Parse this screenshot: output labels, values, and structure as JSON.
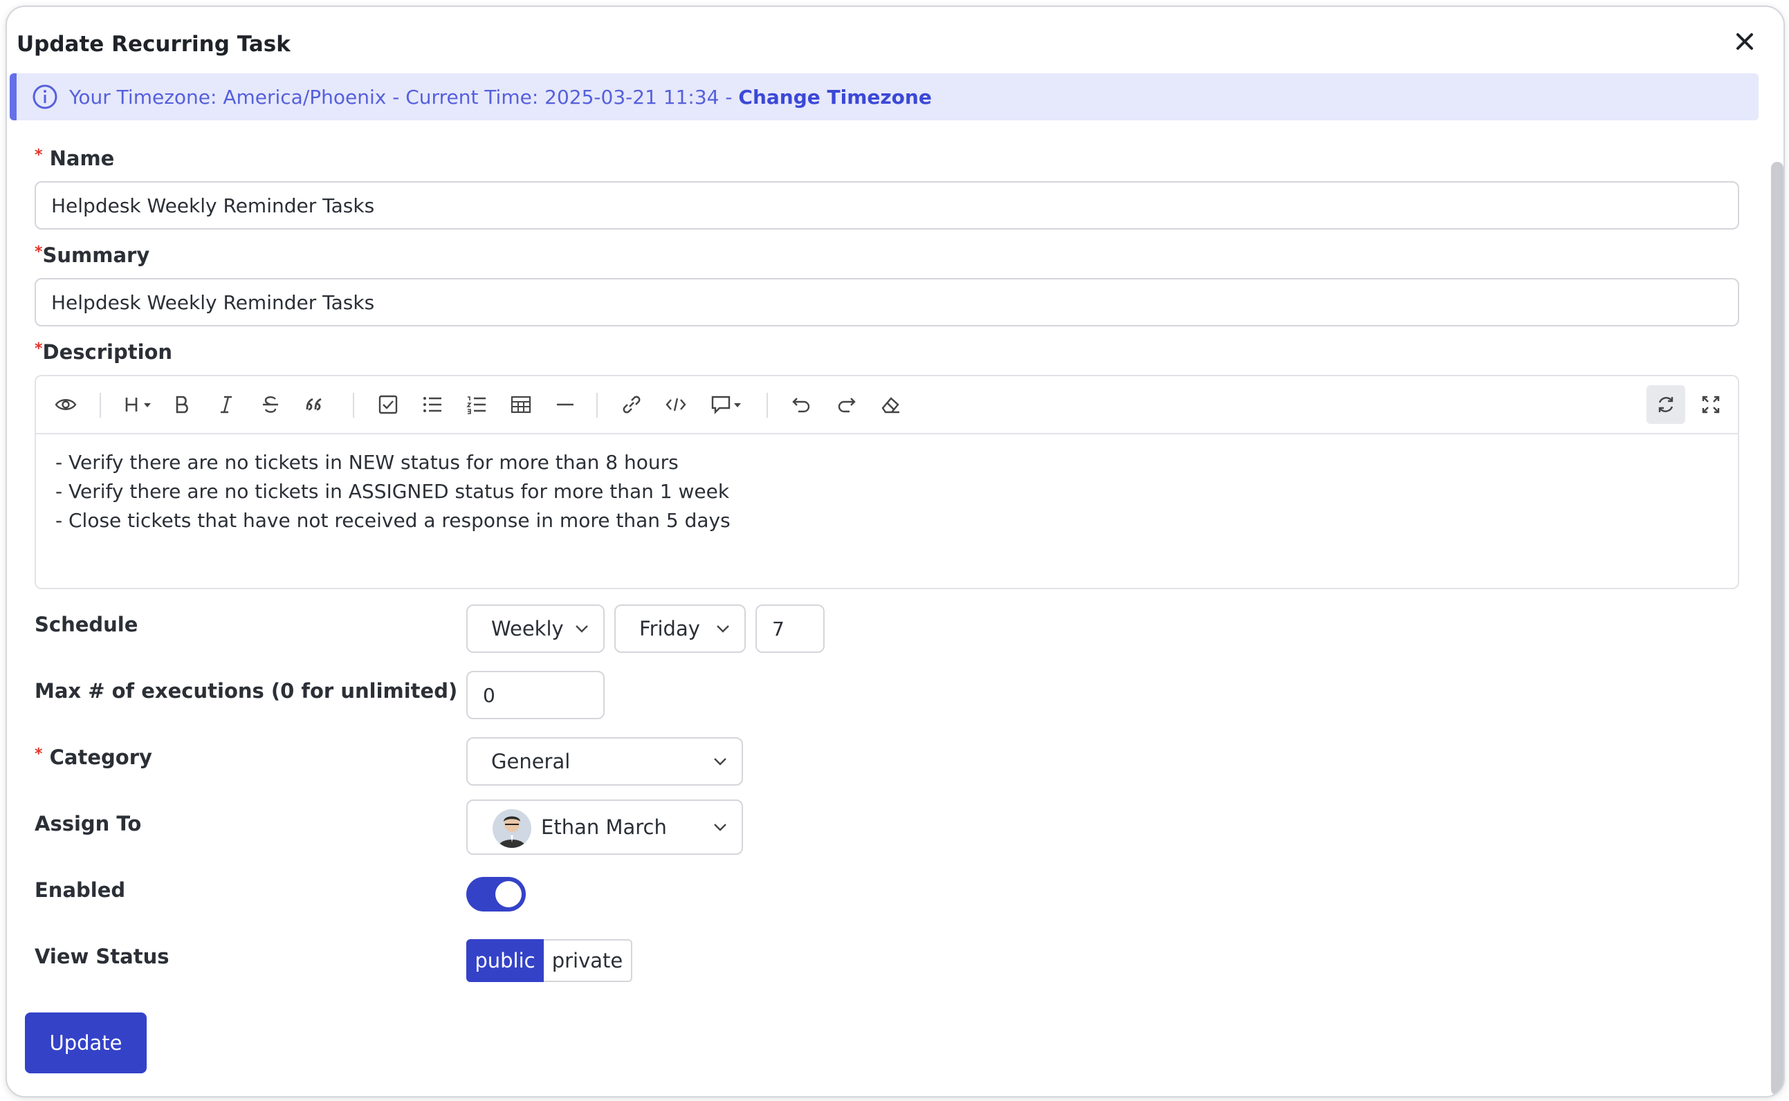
{
  "dialog": {
    "title": "Update Recurring Task"
  },
  "timezone": {
    "text": "Your Timezone: America/Phoenix - Current Time: 2025-03-21 11:34 - ",
    "link": "Change Timezone"
  },
  "form": {
    "name": {
      "label": "Name",
      "value": "Helpdesk Weekly Reminder Tasks"
    },
    "summary": {
      "label": "Summary",
      "value": "Helpdesk Weekly Reminder Tasks"
    },
    "description": {
      "label": "Description",
      "lines": [
        "- Verify there are no tickets in NEW status for more than 8 hours",
        "- Verify there are no tickets in ASSIGNED status for more than 1 week",
        "- Close tickets that have not received a response in more than 5 days"
      ]
    },
    "schedule": {
      "label": "Schedule",
      "frequency": "Weekly",
      "day": "Friday",
      "hour": "7"
    },
    "max_exec": {
      "label": "Max # of executions (0 for unlimited)",
      "value": "0"
    },
    "category": {
      "label": "Category",
      "value": "General"
    },
    "assign_to": {
      "label": "Assign To",
      "value": "Ethan March"
    },
    "enabled": {
      "label": "Enabled",
      "on": true
    },
    "view_status": {
      "label": "View Status",
      "options": [
        "public",
        "private"
      ],
      "selected": "public"
    },
    "submit_label": "Update"
  },
  "colors": {
    "accent": "#3442c8",
    "info_bg": "#e6e8fb",
    "required": "#e4352b"
  },
  "editor_toolbar_icons": [
    "preview-icon",
    "heading-icon",
    "bold-icon",
    "italic-icon",
    "strikethrough-icon",
    "quote-icon",
    "checklist-icon",
    "bullet-list-icon",
    "ordered-list-icon",
    "table-icon",
    "horizontal-rule-icon",
    "link-icon",
    "code-icon",
    "comment-icon",
    "undo-icon",
    "redo-icon",
    "clear-format-icon",
    "sync-scroll-icon",
    "fullscreen-icon"
  ]
}
